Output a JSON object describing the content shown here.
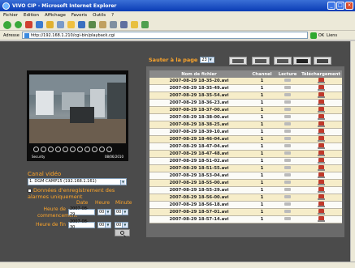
{
  "window": {
    "title": "VIVO CIP - Microsoft Internet Explorer"
  },
  "menu": [
    "Fichier",
    "Edition",
    "Affichage",
    "Favoris",
    "Outils",
    "?"
  ],
  "address": {
    "label": "Adresse",
    "url": "http://192.168.1.210/cgi-bin/playback.cgi",
    "go_label": "OK",
    "links_label": "Liens"
  },
  "toolbar_icons": [
    "back-icon",
    "forward-icon",
    "stop-icon",
    "refresh-icon",
    "home-icon",
    "search-icon",
    "favorites-icon",
    "media-icon",
    "history-icon",
    "mail-icon",
    "print-icon",
    "edit-icon",
    "discuss-icon",
    "messenger-icon"
  ],
  "page": {
    "jump_label": "Sauter à la page",
    "page_value": "23",
    "table_headers": [
      "Nom de fichier",
      "Channel",
      "Lecture",
      "Téléchargement"
    ],
    "files": [
      {
        "name": "2007-08-29 18-35-20.avi",
        "channel": "1"
      },
      {
        "name": "2007-08-29 18-35-49.avi",
        "channel": "1"
      },
      {
        "name": "2007-08-29 18-35-54.avi",
        "channel": "1"
      },
      {
        "name": "2007-08-29 18-36-23.avi",
        "channel": "1"
      },
      {
        "name": "2007-08-29 18-37-00.avi",
        "channel": "1"
      },
      {
        "name": "2007-08-29 18-38-00.avi",
        "channel": "1"
      },
      {
        "name": "2007-08-29 18-38-25.avi",
        "channel": "1"
      },
      {
        "name": "2007-08-29 18-39-10.avi",
        "channel": "1"
      },
      {
        "name": "2007-08-29 18-46-04.avi",
        "channel": "1"
      },
      {
        "name": "2007-08-29 18-47-04.avi",
        "channel": "1"
      },
      {
        "name": "2007-08-29 18-47-48.avi",
        "channel": "1"
      },
      {
        "name": "2007-08-29 18-51-02.avi",
        "channel": "1"
      },
      {
        "name": "2007-08-29 18-51-55.avi",
        "channel": "1"
      },
      {
        "name": "2007-08-29 18-53-04.avi",
        "channel": "1"
      },
      {
        "name": "2007-08-29 18-55-00.avi",
        "channel": "1"
      },
      {
        "name": "2007-08-29 18-55-29.avi",
        "channel": "1"
      },
      {
        "name": "2007-08-29 18-56-00.avi",
        "channel": "1"
      },
      {
        "name": "2007-08-29 18-56-18.avi",
        "channel": "1"
      },
      {
        "name": "2007-08-29 18-57-01.avi",
        "channel": "1"
      },
      {
        "name": "2007-08-29 18-57-14.avi",
        "channel": "1"
      }
    ],
    "video": {
      "left_caption": "Security",
      "right_caption": "08/06/2010"
    },
    "canal_label": "Canal vidéo",
    "canal_value": "1. DGM CAMP15 (192.168.1.161)",
    "alarm_label": "Données d'enregistrement des alarmes uniquement",
    "col_date": "Date",
    "col_heure": "Heure",
    "col_minute": "Minute",
    "start_label_1": "Heure de",
    "start_label_2": "commencement",
    "end_label": "Heure de fin",
    "start_date": "2007-08-29",
    "start_hour": "00",
    "start_min": "00",
    "end_date": "2007-08-30",
    "end_hour": "00",
    "end_min": "00"
  },
  "colors": {
    "accent": "#ffa62a",
    "background": "#4b4b4b",
    "row_odd": "#f6edc9",
    "row_even": "#fbfbf7"
  }
}
